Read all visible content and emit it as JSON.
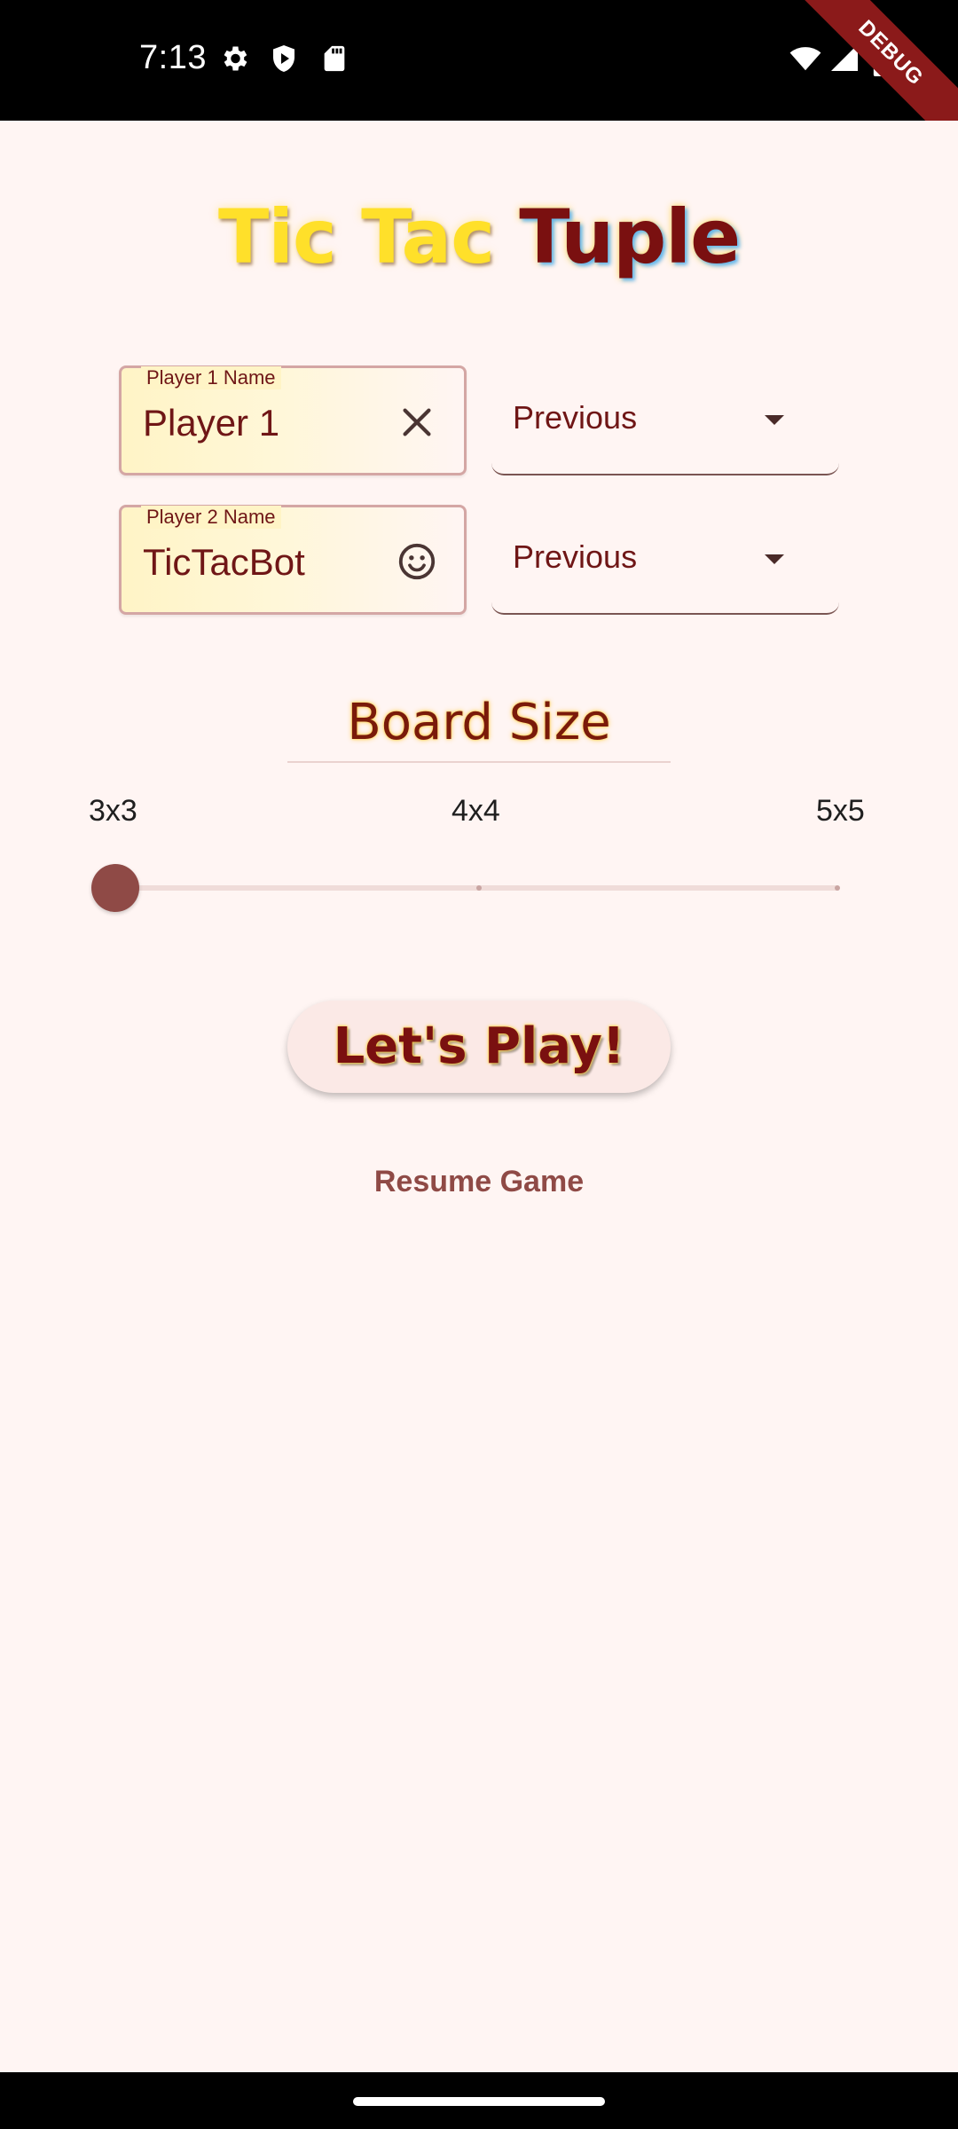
{
  "status_bar": {
    "time": "7:13",
    "left_icons": [
      "gear-icon",
      "shield-icon",
      "sd-card-icon"
    ],
    "right_icons": [
      "wifi-icon",
      "signal-icon",
      "battery-icon"
    ],
    "debug_banner": "DEBUG"
  },
  "title": {
    "part1": "Tic Tac",
    "part2": "Tuple",
    "colors": {
      "part1": "#ffe02a",
      "part2": "#7a1010"
    }
  },
  "players": [
    {
      "label": "Player 1 Name",
      "value": "Player 1",
      "trailing_icon": "clear-icon",
      "dropdown_value": "Previous"
    },
    {
      "label": "Player 2 Name",
      "value": "TicTacBot",
      "trailing_icon": "smiley-icon",
      "dropdown_value": "Previous"
    }
  ],
  "board_size": {
    "heading": "Board Size",
    "options": [
      "3x3",
      "4x4",
      "5x5"
    ],
    "selected": "3x3",
    "selected_index": 0
  },
  "actions": {
    "play_label": "Let's Play!",
    "resume_label": "Resume Game"
  },
  "theme": {
    "background": "#fff5f3",
    "accent": "#8f4a46",
    "text": "#6f1616"
  }
}
